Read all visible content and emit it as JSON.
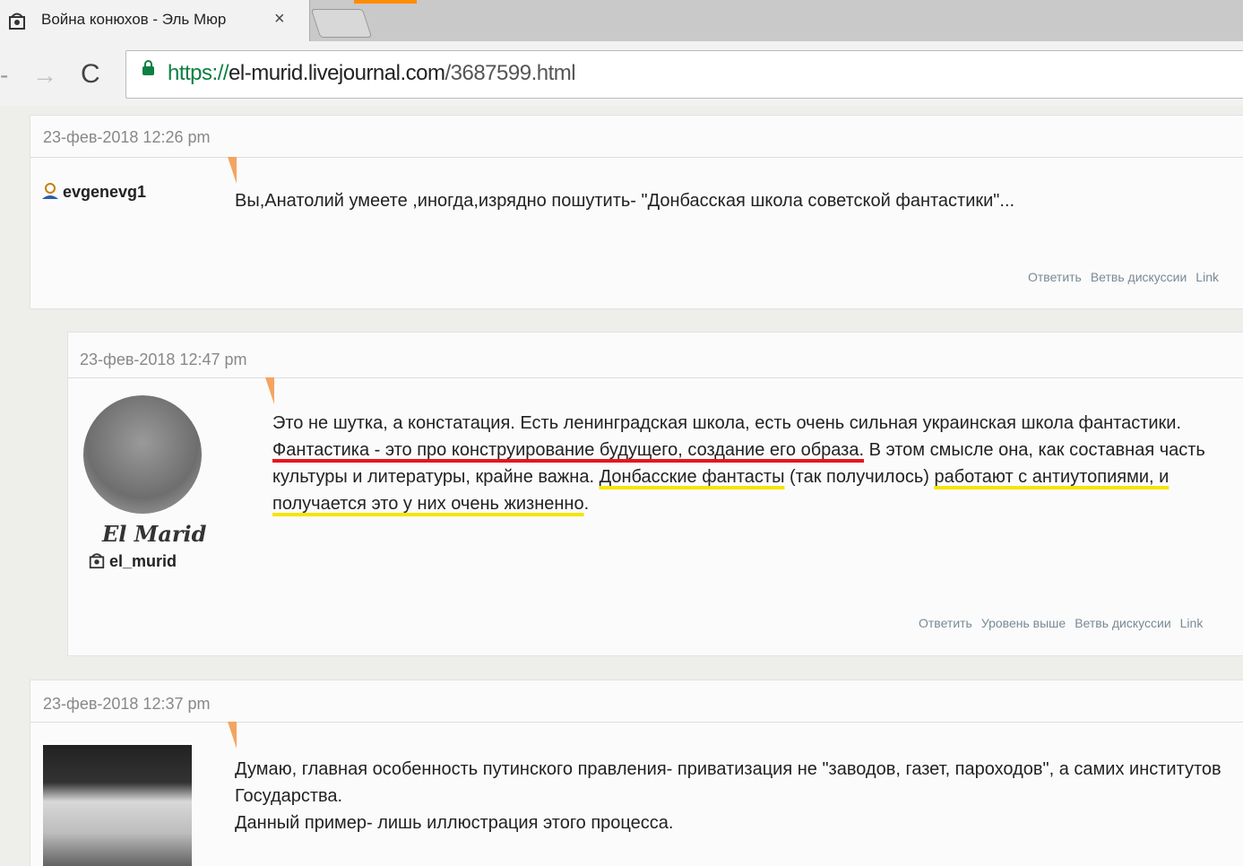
{
  "browser": {
    "tab_title": "Война конюхов - Эль Мюр",
    "tab_close": "×",
    "url_scheme": "https://",
    "url_host": "el-murid.livejournal.com",
    "url_path": "/3687599.html"
  },
  "comments": [
    {
      "date": "23-фев-2018 12:26 pm",
      "user": "evgenevg1",
      "text": "Вы,Анатолий умеете ,иногда,изрядно пошутить- \"Донбасская школа советской фантастики\"...",
      "actions": [
        "Ответить",
        "Ветвь дискуссии",
        "Link"
      ]
    },
    {
      "date": "23-фев-2018 12:47 pm",
      "user": "el_murid",
      "avatar_signature": "El Marid",
      "text_parts": {
        "p1": "Это не шутка, а констатация. Есть ленинградская школа, есть очень сильная украинская школа фантастики. ",
        "red": "Фантастика - это про конструирование будущего, создание его образа.",
        "p2": " В этом смысле она, как составная часть культуры и литературы, крайне важна. ",
        "yel1": "Донбасские фантасты",
        "p3": " (так получилось) ",
        "yel2": "работают с антиутопиями, и получается это у них очень жизненно",
        "p4": "."
      },
      "actions": [
        "Ответить",
        "Уровень выше",
        "Ветвь дискуссии",
        "Link"
      ]
    },
    {
      "date": "23-фев-2018 12:37 pm",
      "text_line1": "Думаю, главная особенность путинского правления- приватизация не \"заводов, газет, пароходов\", а самих институтов Государства.",
      "text_line2": "Данный пример- лишь иллюстрация этого процесса."
    }
  ],
  "colors": {
    "arrow": "#f4a460",
    "underline_red": "#e8141e",
    "underline_yellow": "#f5e400",
    "url_green": "#0b8043"
  }
}
